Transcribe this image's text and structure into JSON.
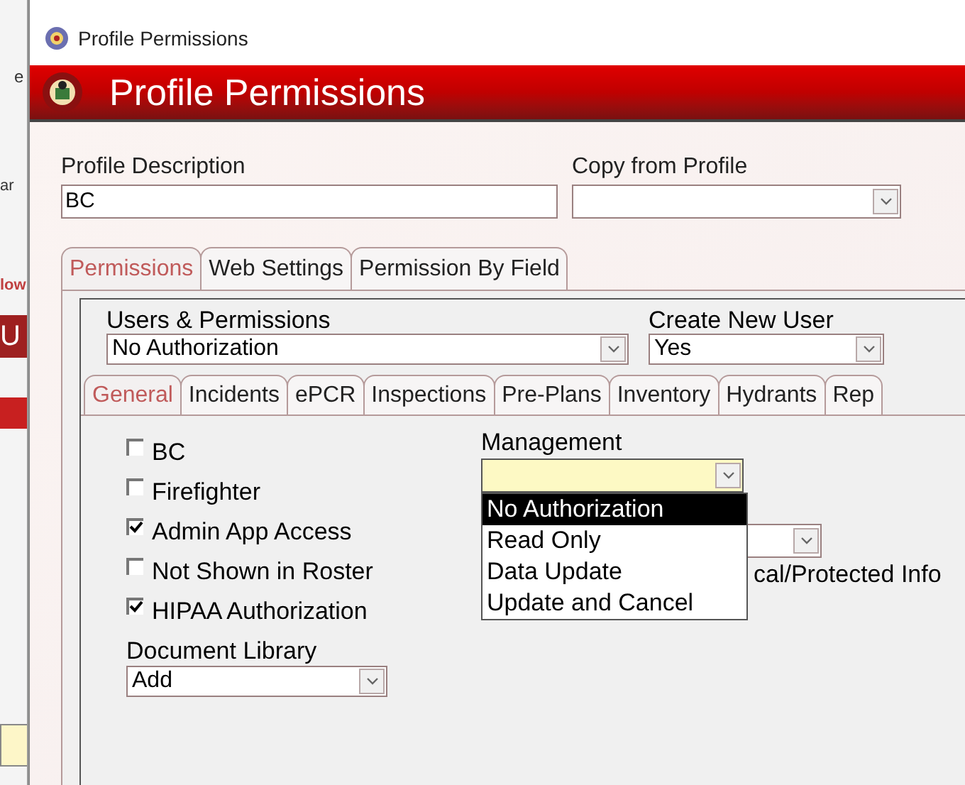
{
  "background_window": {
    "fragments": [
      "e",
      "ar",
      "low",
      "U"
    ]
  },
  "window": {
    "title": "Profile Permissions"
  },
  "banner": {
    "title": "Profile Permissions"
  },
  "profile_description": {
    "label": "Profile Description",
    "value": "BC"
  },
  "copy_from_profile": {
    "label": "Copy from Profile"
  },
  "tabs": [
    {
      "label": "Permissions",
      "selected": true
    },
    {
      "label": "Web Settings",
      "selected": false
    },
    {
      "label": "Permission By Field",
      "selected": false
    }
  ],
  "users_permissions": {
    "label": "Users & Permissions",
    "value": "No Authorization"
  },
  "create_new_user": {
    "label": "Create New User",
    "value": "Yes"
  },
  "module_tabs": [
    {
      "label": "General",
      "selected": true
    },
    {
      "label": "Incidents",
      "selected": false
    },
    {
      "label": "ePCR",
      "selected": false
    },
    {
      "label": "Inspections",
      "selected": false
    },
    {
      "label": "Pre-Plans",
      "selected": false
    },
    {
      "label": "Inventory",
      "selected": false
    },
    {
      "label": "Hydrants",
      "selected": false
    },
    {
      "label": "Rep",
      "selected": false
    }
  ],
  "checkboxes": [
    {
      "label": "BC",
      "checked": false
    },
    {
      "label": "Firefighter",
      "checked": false
    },
    {
      "label": "Admin App Access",
      "checked": true
    },
    {
      "label": "Not Shown in Roster",
      "checked": false
    },
    {
      "label": "HIPAA Authorization",
      "checked": true
    }
  ],
  "document_library": {
    "label": "Document Library",
    "value": "Add"
  },
  "management": {
    "label": "Management",
    "expanded": true,
    "options": [
      {
        "label": "No Authorization",
        "selected": true
      },
      {
        "label": "Read Only",
        "selected": false
      },
      {
        "label": "Data Update",
        "selected": false
      },
      {
        "label": "Update and Cancel",
        "selected": false
      }
    ]
  },
  "medical_label": "cal/Protected Info"
}
